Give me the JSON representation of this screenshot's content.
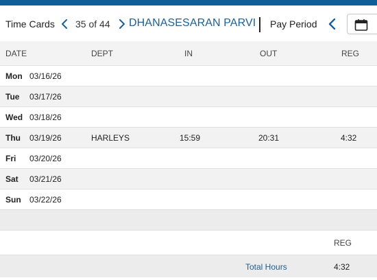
{
  "colors": {
    "accent": "#1a5f96",
    "top_strip": "#0f5d99",
    "divider": "#222222"
  },
  "toolbar": {
    "title": "Time Cards",
    "prev_icon": "chevron-left-icon",
    "count": "35 of 44",
    "next_icon": "chevron-right-icon",
    "employee_name": "DHANASESARAN PARVI",
    "pay_period_label": "Pay Period",
    "pay_period_prev_icon": "chevron-left-icon",
    "calendar_icon": "calendar-icon"
  },
  "table": {
    "columns": [
      "DATE",
      "DEPT",
      "IN",
      "OUT",
      "REG"
    ],
    "rows": [
      {
        "day": "Mon",
        "date": "03/16/26",
        "dept": "",
        "in": "",
        "out": "",
        "reg": ""
      },
      {
        "day": "Tue",
        "date": "03/17/26",
        "dept": "",
        "in": "",
        "out": "",
        "reg": ""
      },
      {
        "day": "Wed",
        "date": "03/18/26",
        "dept": "",
        "in": "",
        "out": "",
        "reg": ""
      },
      {
        "day": "Thu",
        "date": "03/19/26",
        "dept": "HARLEYS",
        "in": "15:59",
        "out": "20:31",
        "reg": "4:32"
      },
      {
        "day": "Fri",
        "date": "03/20/26",
        "dept": "",
        "in": "",
        "out": "",
        "reg": ""
      },
      {
        "day": "Sat",
        "date": "03/21/26",
        "dept": "",
        "in": "",
        "out": "",
        "reg": ""
      },
      {
        "day": "Sun",
        "date": "03/22/26",
        "dept": "",
        "in": "",
        "out": "",
        "reg": ""
      }
    ]
  },
  "summary": {
    "reg_header": "REG",
    "total_label": "Total Hours",
    "total_reg": "4:32"
  }
}
